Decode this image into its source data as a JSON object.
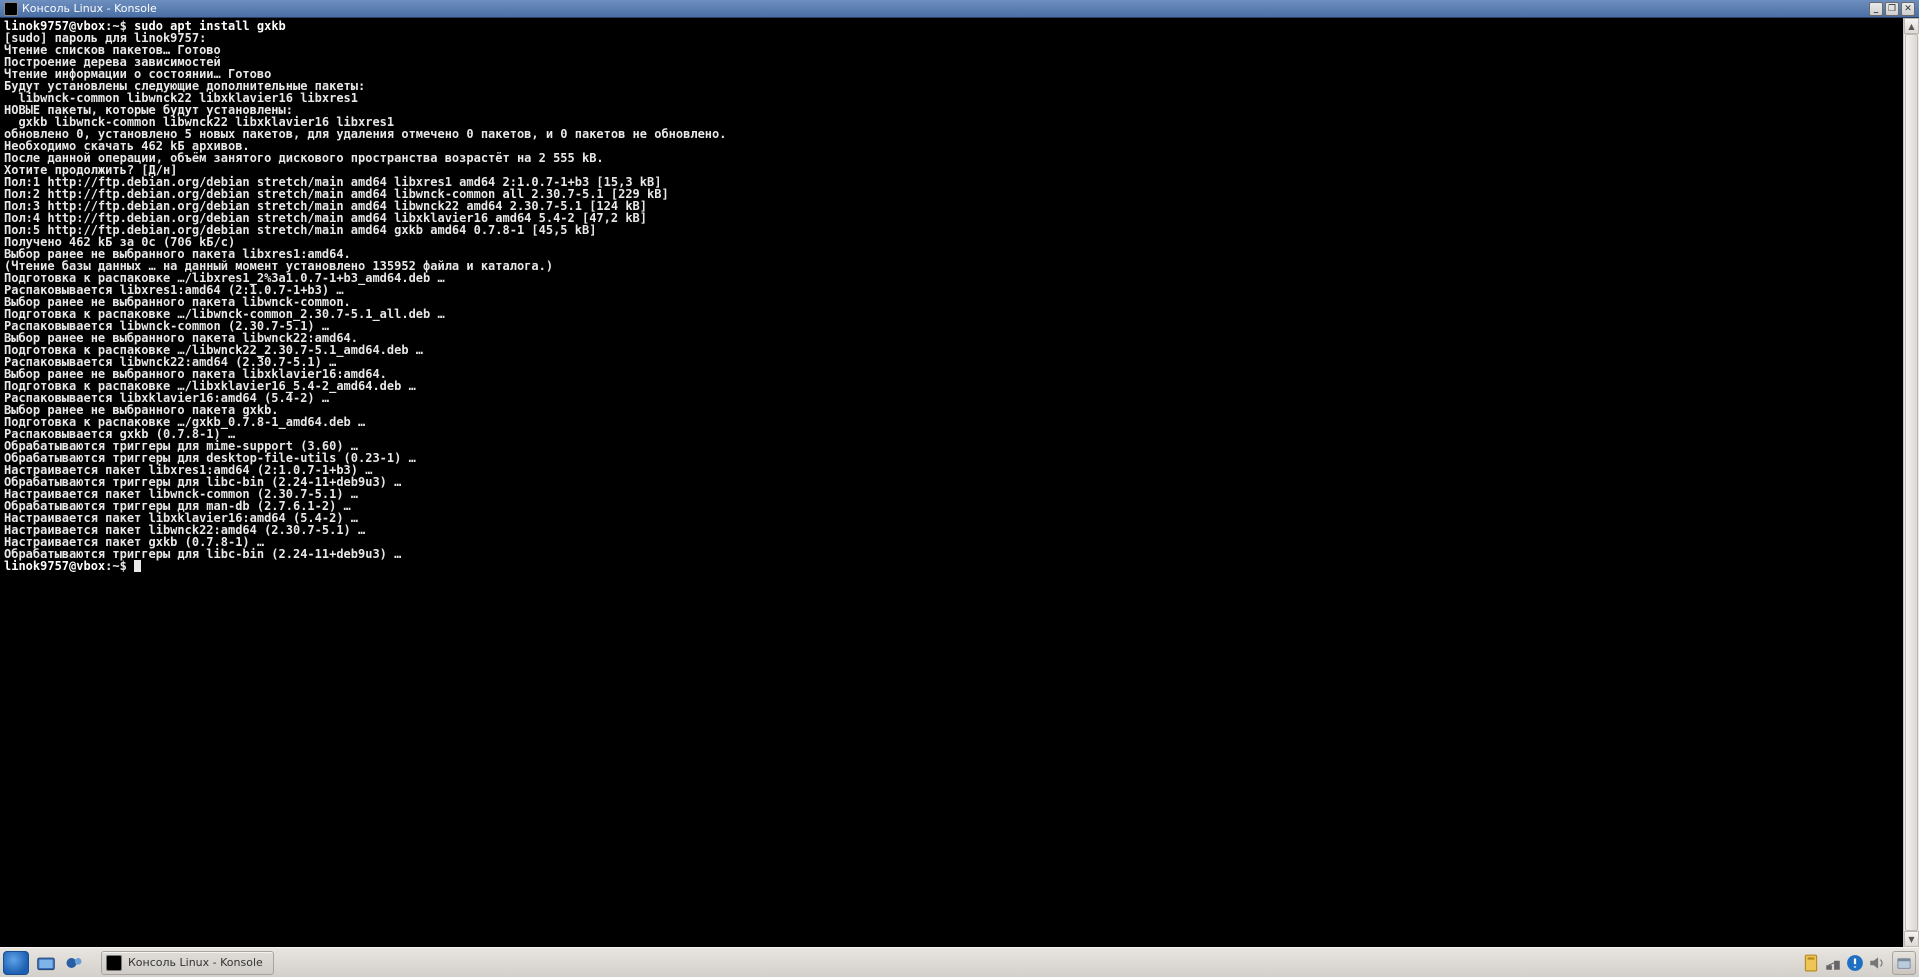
{
  "window": {
    "title": "Консоль Linux - Konsole"
  },
  "terminal": {
    "prompt1_user": "linok9757@vbox",
    "prompt1_sep": ":~$ ",
    "command1": "sudo apt install gxkb",
    "lines": [
      "[sudo] пароль для linok9757:",
      "Чтение списков пакетов… Готово",
      "Построение дерева зависимостей",
      "Чтение информации о состоянии… Готово",
      "Будут установлены следующие дополнительные пакеты:",
      "  libwnck-common libwnck22 libxklavier16 libxres1",
      "НОВЫЕ пакеты, которые будут установлены:",
      "  gxkb libwnck-common libwnck22 libxklavier16 libxres1",
      "обновлено 0, установлено 5 новых пакетов, для удаления отмечено 0 пакетов, и 0 пакетов не обновлено.",
      "Необходимо скачать 462 kБ архивов.",
      "После данной операции, объём занятого дискового пространства возрастёт на 2 555 kB.",
      "Хотите продолжить? [Д/н]",
      "Пол:1 http://ftp.debian.org/debian stretch/main amd64 libxres1 amd64 2:1.0.7-1+b3 [15,3 kB]",
      "Пол:2 http://ftp.debian.org/debian stretch/main amd64 libwnck-common all 2.30.7-5.1 [229 kB]",
      "Пол:3 http://ftp.debian.org/debian stretch/main amd64 libwnck22 amd64 2.30.7-5.1 [124 kB]",
      "Пол:4 http://ftp.debian.org/debian stretch/main amd64 libxklavier16 amd64 5.4-2 [47,2 kB]",
      "Пол:5 http://ftp.debian.org/debian stretch/main amd64 gxkb amd64 0.7.8-1 [45,5 kB]",
      "Получено 462 kБ за 0с (706 kБ/c)",
      "Выбор ранее не выбранного пакета libxres1:amd64.",
      "(Чтение базы данных … на данный момент установлено 135952 файла и каталога.)",
      "Подготовка к распаковке …/libxres1_2%3a1.0.7-1+b3_amd64.deb …",
      "Распаковывается libxres1:amd64 (2:1.0.7-1+b3) …",
      "Выбор ранее не выбранного пакета libwnck-common.",
      "Подготовка к распаковке …/libwnck-common_2.30.7-5.1_all.deb …",
      "Распаковывается libwnck-common (2.30.7-5.1) …",
      "Выбор ранее не выбранного пакета libwnck22:amd64.",
      "Подготовка к распаковке …/libwnck22_2.30.7-5.1_amd64.deb …",
      "Распаковывается libwnck22:amd64 (2.30.7-5.1) …",
      "Выбор ранее не выбранного пакета libxklavier16:amd64.",
      "Подготовка к распаковке …/libxklavier16_5.4-2_amd64.deb …",
      "Распаковывается libxklavier16:amd64 (5.4-2) …",
      "Выбор ранее не выбранного пакета gxkb.",
      "Подготовка к распаковке …/gxkb_0.7.8-1_amd64.deb …",
      "Распаковывается gxkb (0.7.8-1) …",
      "Обрабатываются триггеры для mime-support (3.60) …",
      "Обрабатываются триггеры для desktop-file-utils (0.23-1) …",
      "Настраивается пакет libxres1:amd64 (2:1.0.7-1+b3) …",
      "Обрабатываются триггеры для libc-bin (2.24-11+deb9u3) …",
      "Настраивается пакет libwnck-common (2.30.7-5.1) …",
      "Обрабатываются триггеры для man-db (2.7.6.1-2) …",
      "Настраивается пакет libxklavier16:amd64 (5.4-2) …",
      "Настраивается пакет libwnck22:amd64 (2.30.7-5.1) …",
      "Настраивается пакет gxkb (0.7.8-1) …",
      "Обрабатываются триггеры для libc-bin (2.24-11+deb9u3) …"
    ],
    "prompt2_user": "linok9757@vbox",
    "prompt2_sep": ":~$ "
  },
  "taskbar": {
    "task_label": "Консоль Linux - Konsole"
  }
}
